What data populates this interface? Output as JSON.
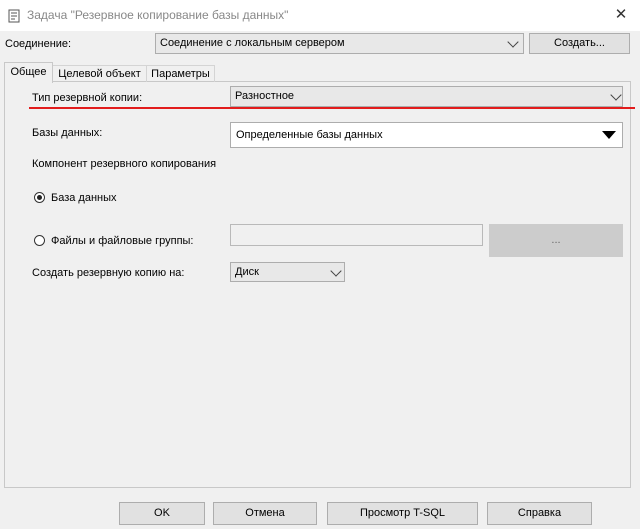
{
  "window": {
    "title": "Задача \"Резервное копирование базы данных\""
  },
  "connection": {
    "label": "Соединение:",
    "value": "Соединение с локальным сервером",
    "create_label": "Создать..."
  },
  "tabs": [
    {
      "label": "Общее"
    },
    {
      "label": "Целевой объект"
    },
    {
      "label": "Параметры"
    }
  ],
  "general": {
    "backup_type_label": "Тип резервной копии:",
    "backup_type_value": "Разностное",
    "databases_label": "Базы данных:",
    "databases_value": "Определенные базы данных",
    "component_label": "Компонент резервного копирования",
    "radio_database_label": "База данных",
    "radio_files_label": "Файлы и файловые группы:",
    "files_value": "",
    "browse_label": "...",
    "backup_to_label": "Создать резервную копию на:",
    "backup_to_value": "Диск"
  },
  "footer": {
    "ok": "OK",
    "cancel": "Отмена",
    "tsql": "Просмотр T-SQL",
    "help": "Справка"
  },
  "colors": {
    "annotation_underline": "#e21c1c",
    "background": "#f0f0f0"
  }
}
